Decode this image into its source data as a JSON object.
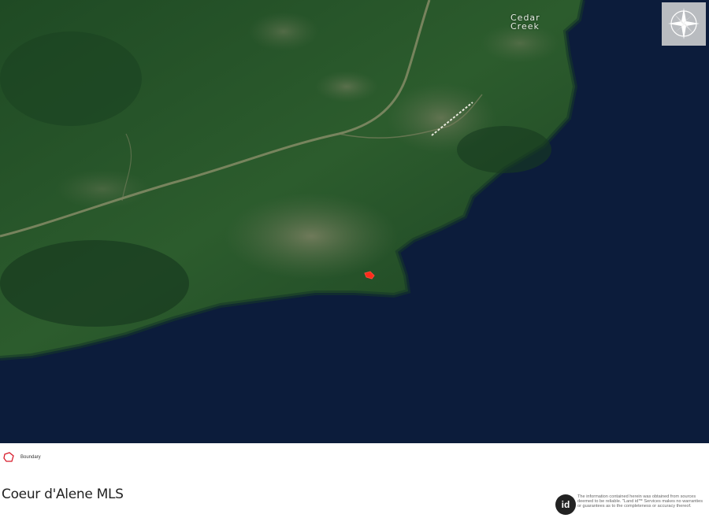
{
  "map": {
    "place_label_lines": [
      "Cedar",
      "Creek"
    ],
    "land_color": "#2a5a2c",
    "water_color": "#0c1c3b",
    "parcel_color": "#ff2a1a"
  },
  "compass": {
    "icon": "compass-rose-icon"
  },
  "legend": {
    "label": "Boundary",
    "swatch_color": "#d81b2b"
  },
  "footer": {
    "brand": "Coeur d'Alene MLS",
    "logo_text": "id",
    "disclaimer": "The information contained herein was obtained from sources deemed to be reliable. \"Land id™ Services makes no warranties or guarantees as to the completeness or accuracy thereof."
  }
}
